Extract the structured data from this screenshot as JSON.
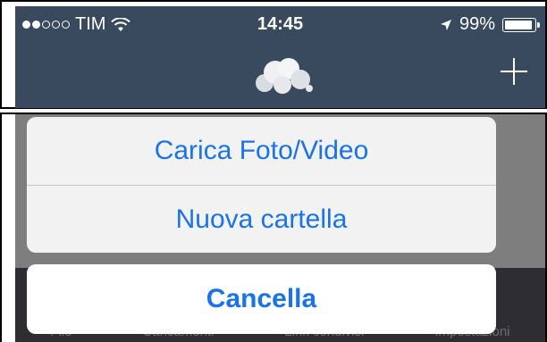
{
  "status_bar": {
    "carrier": "TIM",
    "time": "14:45",
    "battery": "99%"
  },
  "nav": {
    "logo": "owncloud-cloud-logo",
    "add_icon": "plus-icon"
  },
  "action_sheet": {
    "items": [
      {
        "label": "Carica Foto/Video"
      },
      {
        "label": "Nuova cartella"
      }
    ],
    "cancel_label": "Cancella"
  },
  "tab_bar": {
    "tabs": [
      {
        "label": "File"
      },
      {
        "label": "Caricamenti"
      },
      {
        "label": "Link condivisi"
      },
      {
        "label": "Impostazioni"
      }
    ]
  },
  "colors": {
    "nav_bg": "#3a4a5e",
    "accent": "#1a73e8",
    "overlay": "#7e7e7e"
  }
}
